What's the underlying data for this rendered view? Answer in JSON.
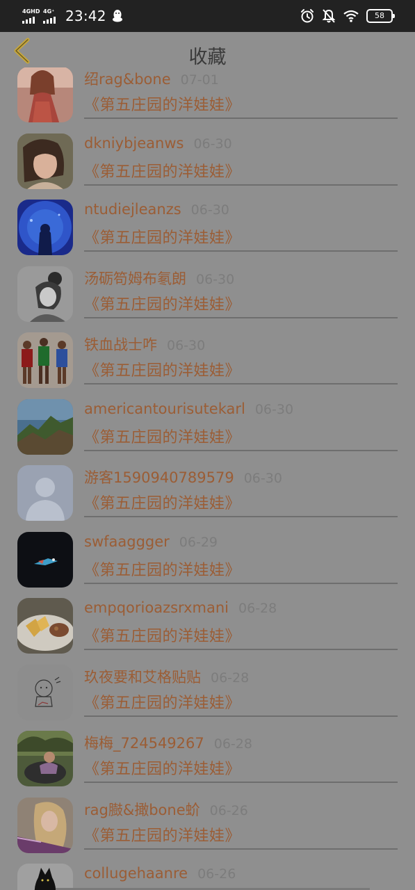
{
  "status_bar": {
    "signal_1_label": "4GHD",
    "signal_2_label": "4G⁺",
    "time": "23:42",
    "battery": "58"
  },
  "header": {
    "title": "收藏",
    "back_icon": "chevron-left-icon"
  },
  "favorites": [
    {
      "user": "绍rag&bone",
      "date": "07-01",
      "book": "《第五庄园的洋娃娃》",
      "avatar": "girl-red-dress"
    },
    {
      "user": "dkniybjeanws",
      "date": "06-30",
      "book": "《第五庄园的洋娃娃》",
      "avatar": "girl-portrait"
    },
    {
      "user": "ntudiejleanzs",
      "date": "06-30",
      "book": "《第五庄园的洋娃娃》",
      "avatar": "aquarium-silhouette"
    },
    {
      "user": "汤砺笱姆布氡朗",
      "date": "06-30",
      "book": "《第五庄园的洋娃娃》",
      "avatar": "bw-girl"
    },
    {
      "user": "铁血战士咋",
      "date": "06-30",
      "book": "《第五庄园的洋娃娃》",
      "avatar": "basketball-players"
    },
    {
      "user": "americantourisutekarl",
      "date": "06-30",
      "book": "《第五庄园的洋娃娃》",
      "avatar": "coastal-cliffs"
    },
    {
      "user": "游客1590940789579",
      "date": "06-30",
      "book": "《第五庄园的洋娃娃》",
      "avatar": "default-user"
    },
    {
      "user": "swfaaggger",
      "date": "06-29",
      "book": "《第五庄园的洋娃娃》",
      "avatar": "dark-spaceship"
    },
    {
      "user": "empqorioazsrxmani",
      "date": "06-28",
      "book": "《第五庄园的洋娃娃》",
      "avatar": "food-plate"
    },
    {
      "user": "玖夜要和艾格贴贴",
      "date": "06-28",
      "book": "《第五庄园的洋娃娃》",
      "avatar": "sketch-character"
    },
    {
      "user": "梅梅_724549267",
      "date": "06-28",
      "book": "《第五庄园的洋娃娃》",
      "avatar": "outdoor-person"
    },
    {
      "user": "rag臌&撖bone蚧",
      "date": "06-26",
      "book": "《第五庄园的洋娃娃》",
      "avatar": "blonde-girl"
    },
    {
      "user": "collugehaanre",
      "date": "06-26",
      "book": "",
      "avatar": "black-cat"
    }
  ],
  "colors": {
    "overlay_background": "#8f8f8f",
    "status_bar": "#222222",
    "accent_text": "#9b5d35",
    "back_arrow": "#c8a83a"
  }
}
